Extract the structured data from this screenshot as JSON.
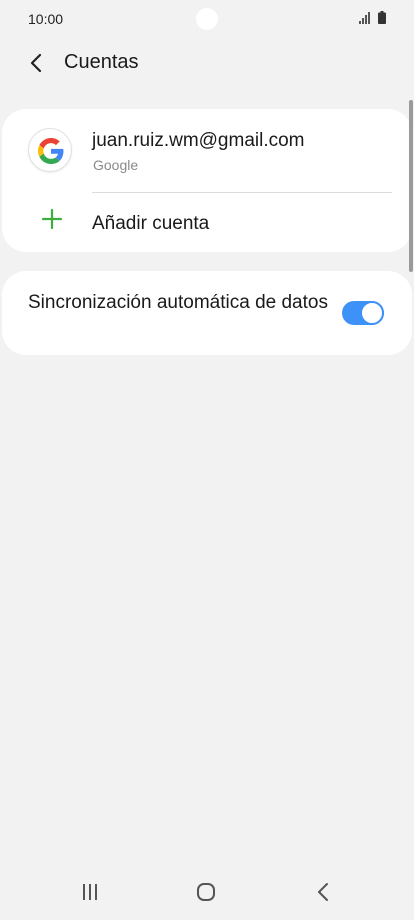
{
  "status_bar": {
    "time": "10:00"
  },
  "header": {
    "title": "Cuentas"
  },
  "accounts": [
    {
      "email": "juan.ruiz.wm@gmail.com",
      "provider": "Google",
      "icon": "google-icon"
    }
  ],
  "add_account": {
    "label": "Añadir cuenta",
    "icon": "plus-icon"
  },
  "sync": {
    "label": "Sincronización automática de datos",
    "enabled": true
  },
  "colors": {
    "accent": "#3e91f7",
    "plus": "#3cae3c",
    "background": "#f2f2f2",
    "card": "#ffffff"
  }
}
